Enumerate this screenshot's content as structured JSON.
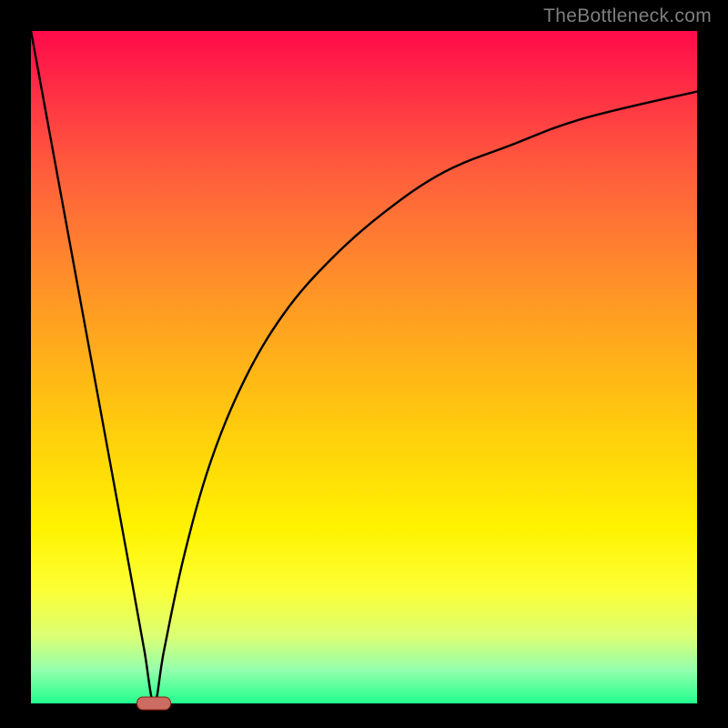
{
  "watermark": "TheBottleneck.com",
  "colors": {
    "frame": "#000000",
    "curve": "#000000",
    "marker_fill": "#cc6d63",
    "marker_border": "#901c12",
    "gradient_top": "#ff0a4a",
    "gradient_bottom": "#22ff8e"
  },
  "chart_data": {
    "type": "line",
    "title": "",
    "xlabel": "",
    "ylabel": "",
    "xlim": [
      0,
      100
    ],
    "ylim": [
      0,
      100
    ],
    "note": "Axes are unlabeled; values below are read off the plot area as percentages of width (x) and height from bottom (y).",
    "series": [
      {
        "name": "left-branch",
        "x": [
          0,
          5,
          10,
          15,
          17,
          18.5
        ],
        "y": [
          100,
          73,
          46,
          19,
          8,
          0
        ]
      },
      {
        "name": "right-branch",
        "x": [
          18.5,
          20,
          23,
          27,
          32,
          38,
          45,
          53,
          62,
          72,
          83,
          100
        ],
        "y": [
          0,
          8,
          22,
          36,
          48,
          58,
          66,
          73,
          79,
          83,
          87,
          91
        ]
      }
    ],
    "marker": {
      "x": 18.5,
      "y": 0,
      "label": ""
    }
  }
}
